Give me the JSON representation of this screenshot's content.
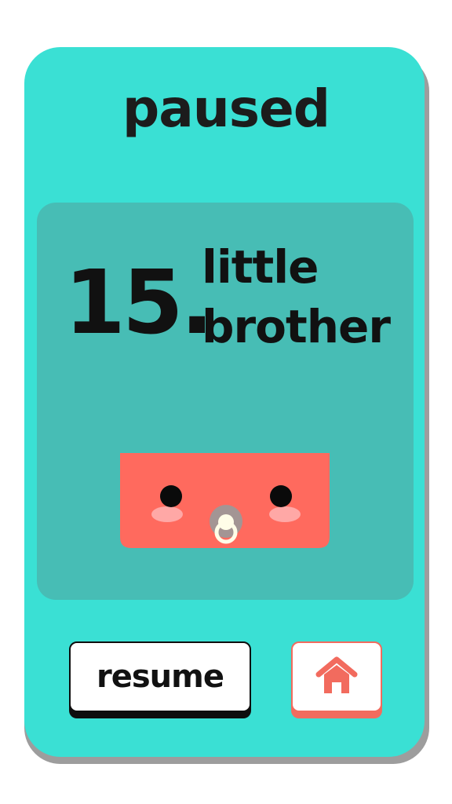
{
  "screen": {
    "title": "paused"
  },
  "level": {
    "number": "15.",
    "name_line1": "little",
    "name_line2": "brother",
    "character_icon": "baby-with-pacifier"
  },
  "buttons": {
    "resume_label": "resume",
    "home_icon": "home-icon"
  },
  "colors": {
    "card": "#3ae0d4",
    "panel": "#47bdb5",
    "character": "#ff6a5e",
    "home_icon": "#f26b5e",
    "text": "#111111"
  }
}
